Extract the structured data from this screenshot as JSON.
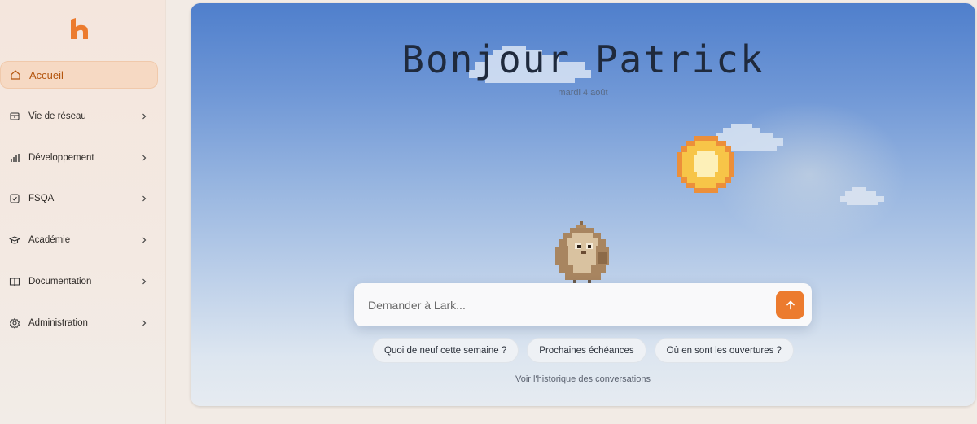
{
  "sidebar": {
    "items": [
      {
        "label": "Accueil",
        "icon": "home-icon",
        "active": true
      },
      {
        "label": "Vie de réseau",
        "icon": "box-icon"
      },
      {
        "label": "Développement",
        "icon": "chart-icon"
      },
      {
        "label": "FSQA",
        "icon": "checkbox-icon"
      },
      {
        "label": "Académie",
        "icon": "graduation-cap-icon"
      },
      {
        "label": "Documentation",
        "icon": "book-icon"
      },
      {
        "label": "Administration",
        "icon": "gear-icon"
      }
    ]
  },
  "main": {
    "greeting": "Bonjour Patrick",
    "date": "mardi 4 août",
    "ask_placeholder": "Demander à Lark...",
    "suggestions": [
      "Quoi de neuf cette semaine ?",
      "Prochaines échéances",
      "Où en sont les ouvertures ?"
    ],
    "history_link": "Voir l'historique des conversations"
  },
  "colors": {
    "accent": "#ec7b2e",
    "active_nav_bg": "#f6d9c3",
    "active_nav_text": "#b4560f",
    "sky_top": "#4f7fcc",
    "sky_bottom": "#e6ebf1"
  }
}
